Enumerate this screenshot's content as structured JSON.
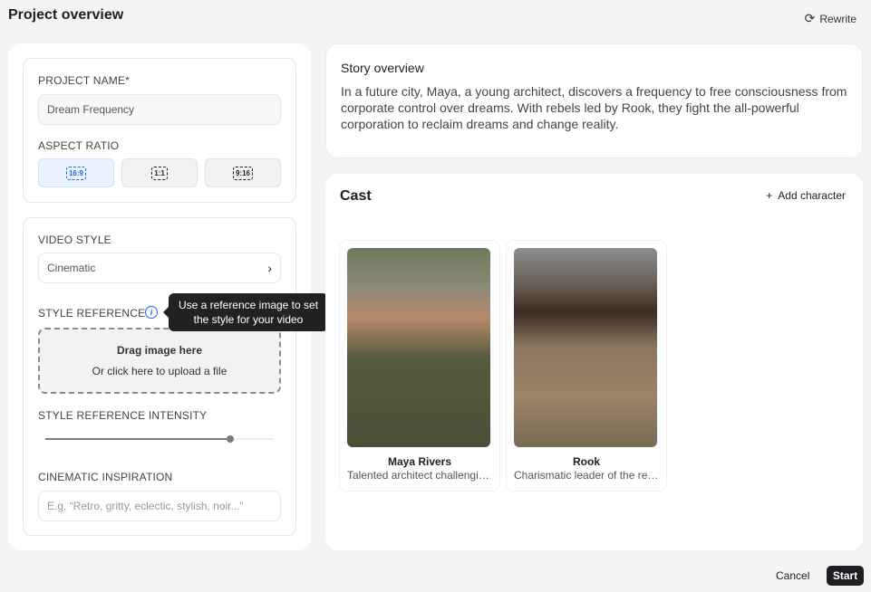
{
  "header": {
    "title": "Project overview",
    "rewrite_label": "Rewrite"
  },
  "project": {
    "name_label": "PROJECT NAME*",
    "name_value": "Dream Frequency",
    "aspect_label": "ASPECT RATIO",
    "aspect_options": [
      "16:9",
      "1:1",
      "9:16"
    ],
    "aspect_selected": "16:9"
  },
  "style": {
    "video_style_label": "VIDEO STYLE",
    "video_style_value": "Cinematic",
    "reference_label": "STYLE REFERENCE",
    "tooltip": "Use a reference image to set the style for your video",
    "drop_title": "Drag image here",
    "drop_sub": "Or click here to upload a file",
    "intensity_label": "STYLE REFERENCE INTENSITY",
    "intensity_percent": 81,
    "inspiration_label": "CINEMATIC INSPIRATION",
    "inspiration_placeholder": "E.g, “Retro, gritty, eclectic, stylish, noir...”"
  },
  "story": {
    "title": "Story overview",
    "text": "In a future city, Maya, a young architect, discovers a frequency to free consciousness from corporate control over dreams. With rebels led by Rook, they fight the all-powerful corporation to reclaim dreams and change reality."
  },
  "cast": {
    "title": "Cast",
    "add_label": "Add character",
    "characters": [
      {
        "name": "Maya Rivers",
        "desc": "Talented architect challenging corporate control"
      },
      {
        "name": "Rook",
        "desc": "Charismatic leader of the rebels"
      }
    ]
  },
  "footer": {
    "cancel": "Cancel",
    "start": "Start"
  },
  "colors": {
    "accent": "#2563eb",
    "primary_button": "#1f1f23"
  }
}
